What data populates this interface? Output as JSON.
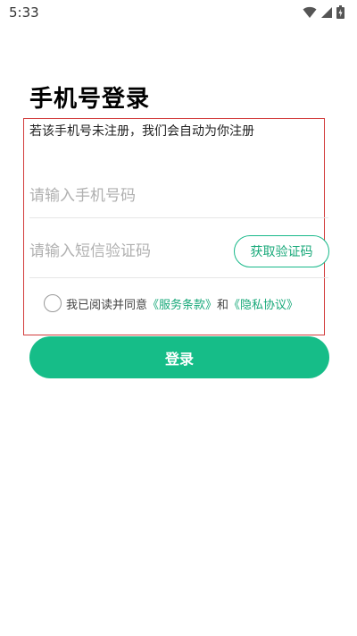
{
  "status_bar": {
    "time": "5:33",
    "icons": [
      "wifi-icon",
      "signal-icon",
      "battery-icon"
    ]
  },
  "page": {
    "title": "手机号登录",
    "hint": "若该手机号未注册，我们会自动为你注册"
  },
  "form": {
    "phone_placeholder": "请输入手机号码",
    "phone_value": "",
    "code_placeholder": "请输入短信验证码",
    "code_value": "",
    "get_code_label": "获取验证码"
  },
  "agreement": {
    "prefix": "我已阅读并同意",
    "terms_link": "《服务条款》",
    "and": "和",
    "privacy_link": "《隐私协议》",
    "checked": false
  },
  "login_button_label": "登录",
  "colors": {
    "accent": "#16bd88",
    "highlight_border": "#d23c3c"
  }
}
